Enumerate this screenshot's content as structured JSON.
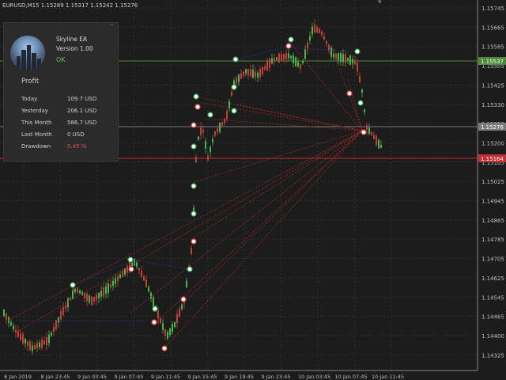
{
  "chart": {
    "title": "EURUSD,M15  1.15289 1.15317 1.15242 1.15276",
    "price_labels": [
      "1.15745",
      "1.15665",
      "1.15585",
      "1.15505",
      "1.15425",
      "1.15330",
      "1.15250",
      "1.15200",
      "1.15105",
      "1.15025",
      "1.14945",
      "1.14865",
      "1.14785",
      "1.14705",
      "1.14625",
      "1.14545",
      "1.14465",
      "1.14400",
      "1.14325"
    ],
    "time_labels": [
      "8 Jan 2019",
      "8 Jan 23:45",
      "9 Jan 03:45",
      "9 Jan 07:45",
      "9 Jan 11:45",
      "9 Jan 15:45",
      "9 Jan 19:45",
      "9 Jan 23:45",
      "10 Jan 03:45",
      "10 Jan 07:45",
      "10 Jan 11:45"
    ],
    "hlines": [
      {
        "label": "1.15537",
        "color": "#4f8a3b"
      },
      {
        "label": "1.15276",
        "color": "#7a7a7a"
      },
      {
        "label": "1.15164",
        "color": "#c03030"
      }
    ],
    "colors": {
      "bull": "#48b64a",
      "bear": "#c0403a",
      "grid": "#2e2e2e",
      "buy_line": "#3030a0",
      "sell_line": "#a02828"
    }
  },
  "ea": {
    "name": "Skyline EA",
    "version": "Version 1.00",
    "status": "OK",
    "collapse_icon": "chevron-up-icon",
    "profit_title": "Profit",
    "rows": [
      {
        "label": "Today",
        "value": "109.7 USD"
      },
      {
        "label": "Yesterday",
        "value": "206.1 USD"
      },
      {
        "label": "This Month",
        "value": "586.7 USD"
      },
      {
        "label": "Last Month",
        "value": "0 USD"
      },
      {
        "label": "Drawdown",
        "value": "0.45 %"
      }
    ],
    "drawdown_color": "#e05a5a"
  }
}
